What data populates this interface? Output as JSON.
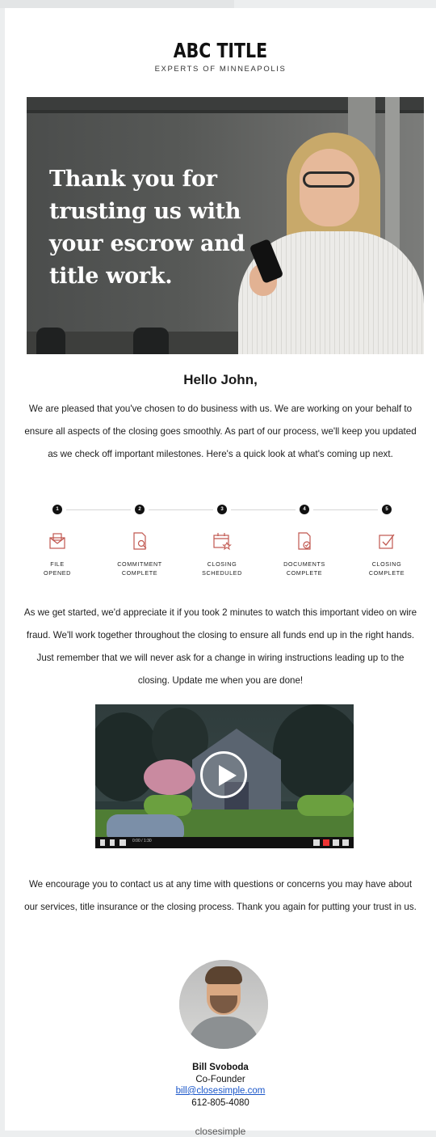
{
  "brand": {
    "title": "ABC TITLE",
    "subtitle": "EXPERTS OF MINNEAPOLIS"
  },
  "hero": {
    "headline": "Thank you for trusting us with your escrow and title work."
  },
  "greeting": "Hello John,",
  "intro_paragraph": "We are pleased that you've chosen to do business with us. We are working on your behalf to ensure all aspects of the closing goes smoothly. As part of our process, we'll keep you updated as we check off important milestones. Here's a quick look at what's coming up next.",
  "steps": [
    {
      "number": "1",
      "icon": "envelope-icon",
      "label_line1": "FILE",
      "label_line2": "OPENED"
    },
    {
      "number": "2",
      "icon": "document-search-icon",
      "label_line1": "COMMITMENT",
      "label_line2": "COMPLETE"
    },
    {
      "number": "3",
      "icon": "calendar-star-icon",
      "label_line1": "CLOSING",
      "label_line2": "SCHEDULED"
    },
    {
      "number": "4",
      "icon": "document-check-icon",
      "label_line1": "DOCUMENTS",
      "label_line2": "COMPLETE"
    },
    {
      "number": "5",
      "icon": "checkbox-icon",
      "label_line1": "CLOSING",
      "label_line2": "COMPLETE"
    }
  ],
  "video_paragraph": "As we get started, we'd appreciate it if you took 2 minutes to watch this important video on wire fraud. We'll work together throughout the closing to ensure all funds end up in the right hands. Just remember that we will never ask for a change in wiring instructions leading up to the closing. Update me when you are done!",
  "video": {
    "time": "0:00 / 1:30"
  },
  "closing_paragraph": "We encourage you to contact us at any time with questions or concerns you may have about our services, title insurance or the closing process. Thank you again for putting your trust in us.",
  "signature": {
    "name": "Bill Svoboda",
    "title": "Co-Founder",
    "email": "bill@closesimple.com",
    "phone": "612-805-4080"
  },
  "footer": {
    "logo_text": "closesimple"
  },
  "colors": {
    "accent": "#c0574f",
    "link": "#1a56c9",
    "dark": "#111111"
  }
}
